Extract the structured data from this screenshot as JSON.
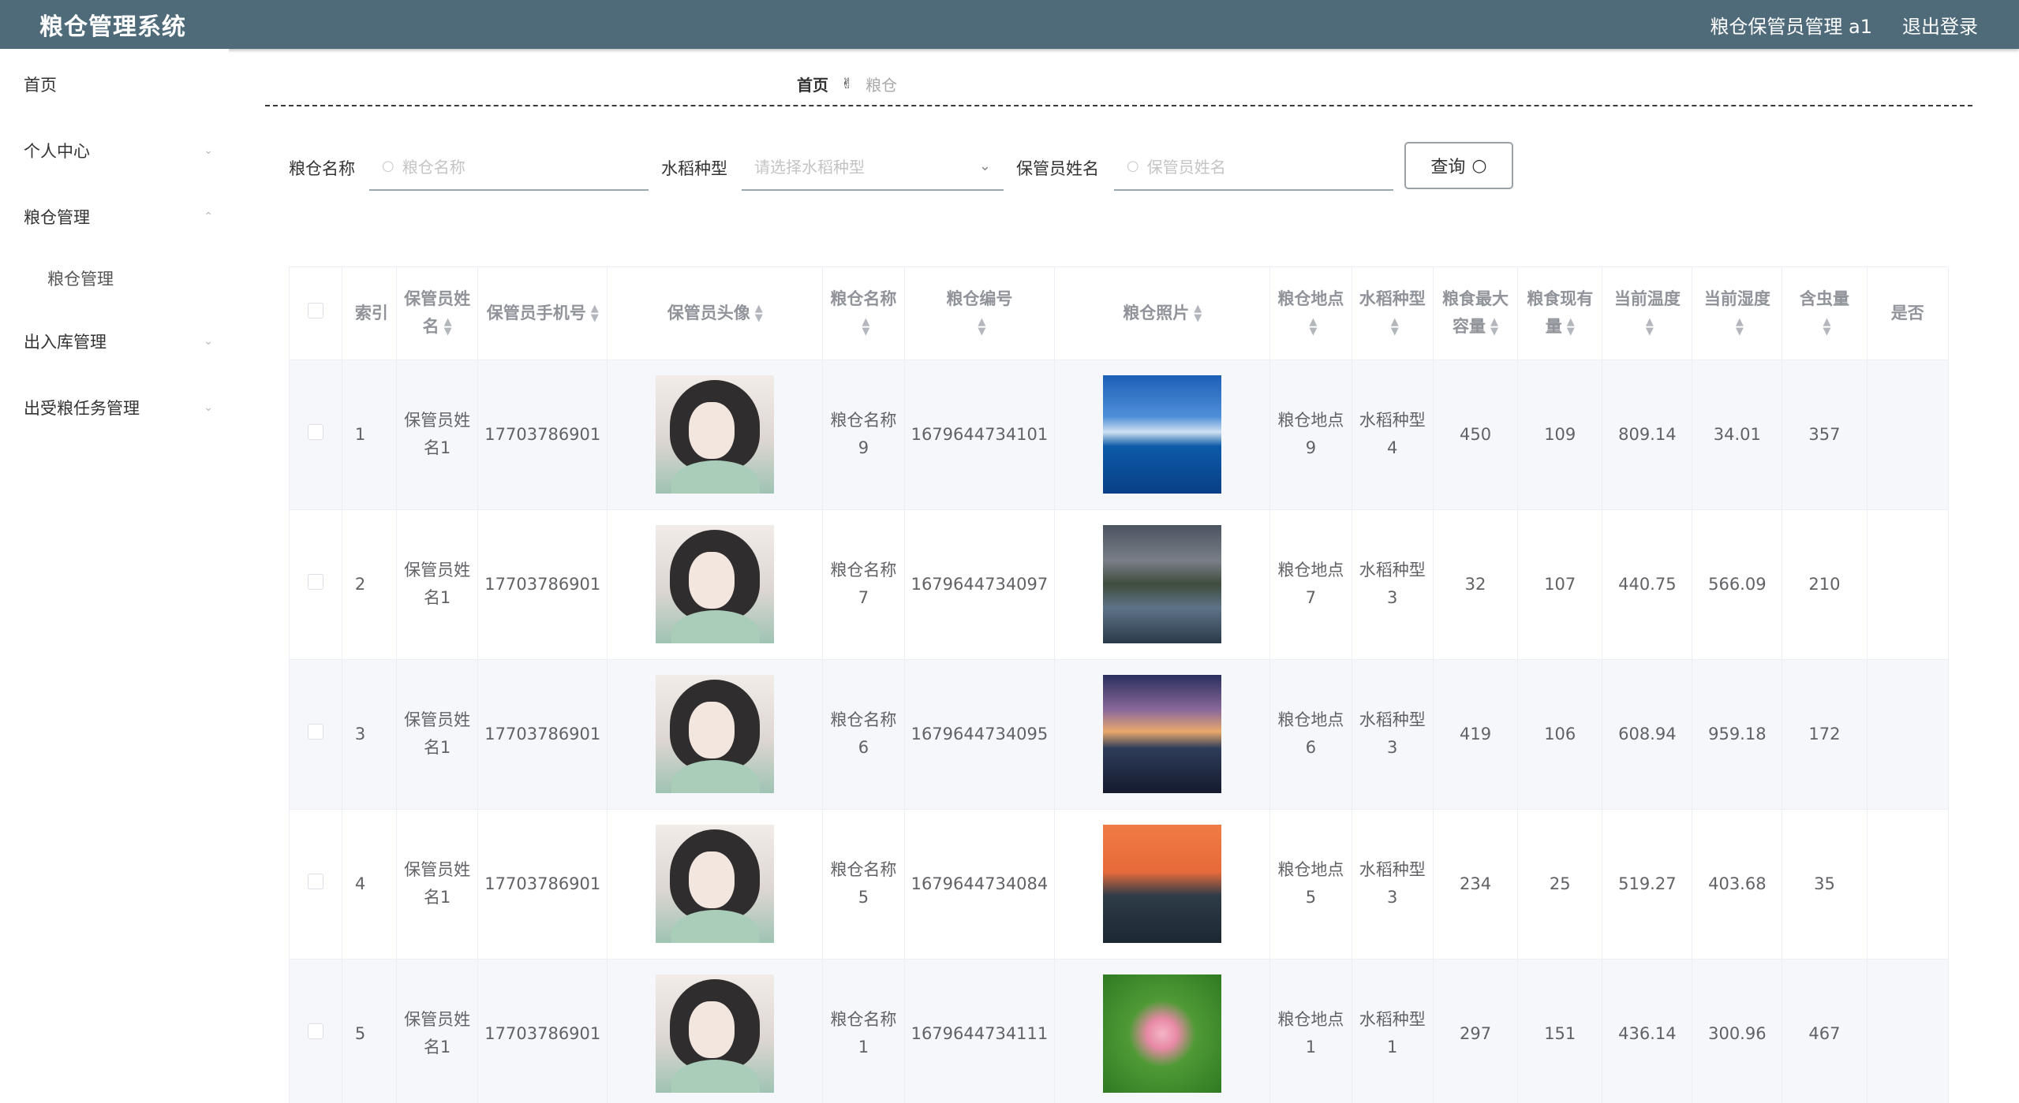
{
  "header": {
    "title": "粮仓管理系统",
    "user": "粮仓保管员管理 a1",
    "logout": "退出登录"
  },
  "sidebar": {
    "items": [
      {
        "label": "首页",
        "arrow": ""
      },
      {
        "label": "个人中心",
        "arrow": "⌄"
      },
      {
        "label": "粮仓管理",
        "arrow": "⌃"
      },
      {
        "label": "粮仓管理",
        "arrow": ""
      },
      {
        "label": "出入库管理",
        "arrow": "⌄"
      },
      {
        "label": "出受粮任务管理",
        "arrow": "⌄"
      }
    ]
  },
  "breadcrumb": {
    "home": "首页",
    "separator": "✌",
    "current": "粮仓"
  },
  "search": {
    "name_label": "粮仓名称",
    "name_placeholder": "粮仓名称",
    "rice_label": "水稻种型",
    "rice_placeholder": "请选择水稻种型",
    "keeper_label": "保管员姓名",
    "keeper_placeholder": "保管员姓名",
    "query_button": "查询"
  },
  "table": {
    "headers": [
      "索引",
      "保管员姓名",
      "保管员手机号",
      "保管员头像",
      "粮仓名称",
      "粮仓编号",
      "粮仓照片",
      "粮仓地点",
      "水稻种型",
      "粮食最大容量",
      "粮食现有量",
      "当前温度",
      "当前湿度",
      "含虫量",
      "是否"
    ],
    "rows": [
      {
        "index": "1",
        "keeper": "保管员姓名1",
        "phone": "17703786901",
        "name": "粮仓名称9",
        "code": "1679644734101",
        "place": "粮仓地点9",
        "rice": "水稻种型4",
        "max": "450",
        "current": "109",
        "temp": "809.14",
        "humidity": "34.01",
        "insects": "357"
      },
      {
        "index": "2",
        "keeper": "保管员姓名1",
        "phone": "17703786901",
        "name": "粮仓名称7",
        "code": "1679644734097",
        "place": "粮仓地点7",
        "rice": "水稻种型3",
        "max": "32",
        "current": "107",
        "temp": "440.75",
        "humidity": "566.09",
        "insects": "210"
      },
      {
        "index": "3",
        "keeper": "保管员姓名1",
        "phone": "17703786901",
        "name": "粮仓名称6",
        "code": "1679644734095",
        "place": "粮仓地点6",
        "rice": "水稻种型3",
        "max": "419",
        "current": "106",
        "temp": "608.94",
        "humidity": "959.18",
        "insects": "172"
      },
      {
        "index": "4",
        "keeper": "保管员姓名1",
        "phone": "17703786901",
        "name": "粮仓名称5",
        "code": "1679644734084",
        "place": "粮仓地点5",
        "rice": "水稻种型3",
        "max": "234",
        "current": "25",
        "temp": "519.27",
        "humidity": "403.68",
        "insects": "35"
      },
      {
        "index": "5",
        "keeper": "保管员姓名1",
        "phone": "17703786901",
        "name": "粮仓名称1",
        "code": "1679644734111",
        "place": "粮仓地点1",
        "rice": "水稻种型1",
        "max": "297",
        "current": "151",
        "temp": "436.14",
        "humidity": "300.96",
        "insects": "467"
      }
    ]
  }
}
